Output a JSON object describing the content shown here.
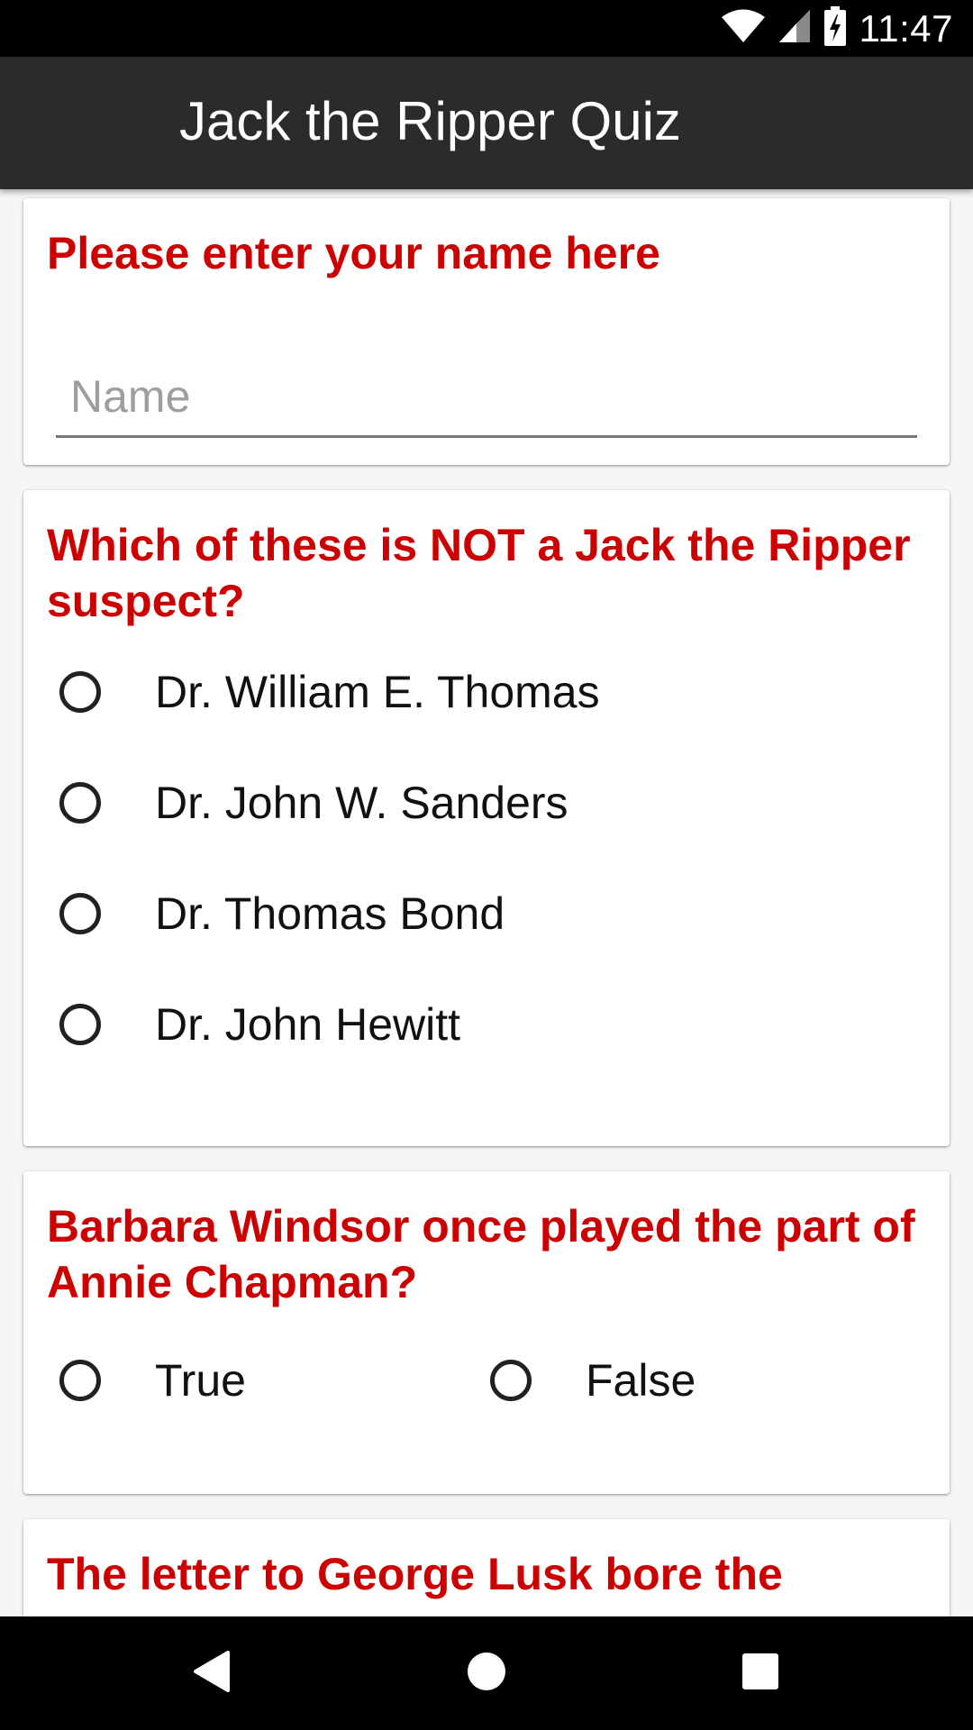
{
  "status_bar": {
    "time": "11:47",
    "icons": [
      "wifi-icon",
      "cell-signal-icon",
      "battery-charging-icon"
    ]
  },
  "app_bar": {
    "title": "Jack the Ripper Quiz"
  },
  "name_card": {
    "prompt": "Please enter your name here",
    "input_value": "",
    "input_placeholder": "Name"
  },
  "question1": {
    "text": "Which of these is NOT a Jack the Ripper suspect?",
    "options": [
      "Dr. William E. Thomas",
      "Dr. John W. Sanders",
      "Dr. Thomas Bond",
      "Dr. John Hewitt"
    ]
  },
  "question2": {
    "text": "Barbara Windsor once played the part of Annie Chapman?",
    "options": [
      "True",
      "False"
    ]
  },
  "question3": {
    "text": "The letter to George Lusk bore the"
  },
  "nav_bar": {
    "buttons": [
      "back-icon",
      "home-icon",
      "recents-icon"
    ]
  },
  "colors": {
    "accent": "#cc0000",
    "app_bar": "#2b2b2b",
    "status_bar": "#000000",
    "background": "#f5f5f5"
  }
}
